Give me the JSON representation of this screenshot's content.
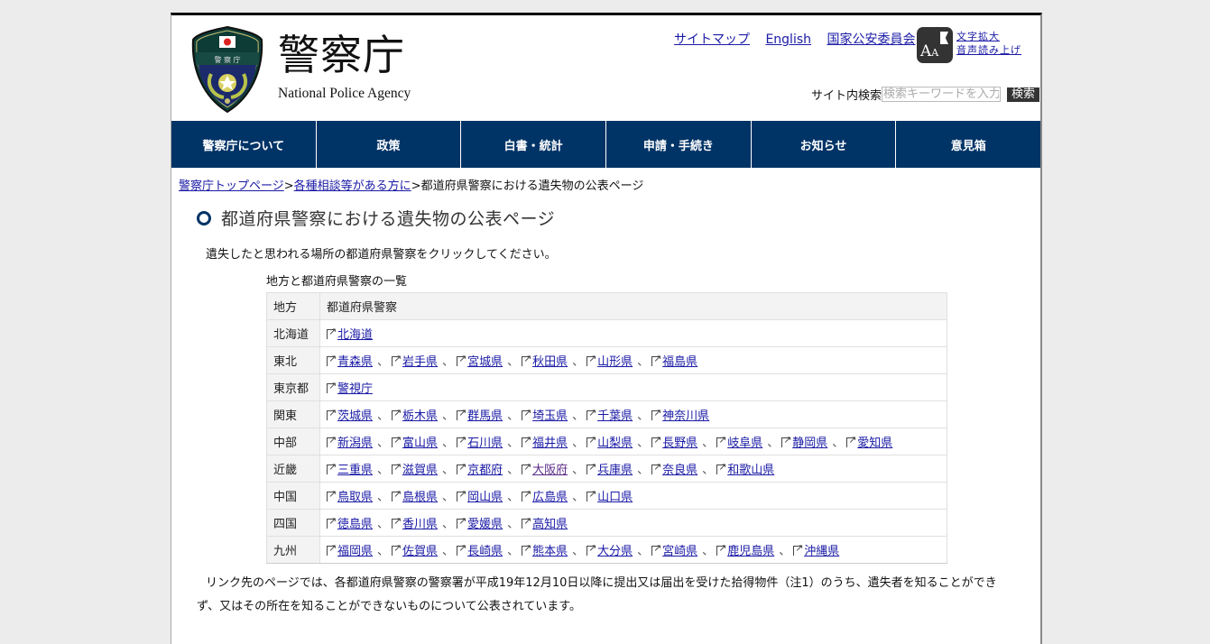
{
  "header": {
    "logo_title": "警察庁",
    "logo_subtitle": "National Police Agency",
    "top_links": [
      "サイトマップ",
      "English",
      "国家公安委員会"
    ],
    "accessibility_links": [
      "文字拡大",
      "音声読み上げ"
    ],
    "search": {
      "label": "サイト内検索",
      "placeholder": "検索キーワードを入力",
      "button": "検索"
    }
  },
  "nav": [
    "警察庁について",
    "政策",
    "白書・統計",
    "申請・手続き",
    "お知らせ",
    "意見箱"
  ],
  "breadcrumb": {
    "items": [
      "警察庁トップページ",
      "各種相談等がある方に"
    ],
    "separator": ">",
    "current": "都道府県警察における遺失物の公表ページ"
  },
  "page": {
    "title": "都道府県警察における遺失物の公表ページ",
    "intro": "遺失したと思われる場所の都道府県警察をクリックしてください。",
    "table_caption": "地方と都道府県警察の一覧",
    "note": "リンク先のページでは、各都道府県警察の警察署が平成19年12月10日以降に提出又は届出を受けた拾得物件（注1）のうち、遺失者を知ることができず、又はその所在を知ることができないものについて公表されています。"
  },
  "table": {
    "headers": [
      "地方",
      "都道府県警察"
    ],
    "separator": "、",
    "rows": [
      {
        "region": "北海道",
        "prefectures": [
          "北海道"
        ]
      },
      {
        "region": "東北",
        "prefectures": [
          "青森県",
          "岩手県",
          "宮城県",
          "秋田県",
          "山形県",
          "福島県"
        ]
      },
      {
        "region": "東京都",
        "prefectures": [
          "警視庁"
        ]
      },
      {
        "region": "関東",
        "prefectures": [
          "茨城県",
          "栃木県",
          "群馬県",
          "埼玉県",
          "千葉県",
          "神奈川県"
        ]
      },
      {
        "region": "中部",
        "prefectures": [
          "新潟県",
          "富山県",
          "石川県",
          "福井県",
          "山梨県",
          "長野県",
          "岐阜県",
          "静岡県",
          "愛知県"
        ]
      },
      {
        "region": "近畿",
        "prefectures": [
          "三重県",
          "滋賀県",
          "京都府",
          "大阪府",
          "兵庫県",
          "奈良県",
          "和歌山県"
        ],
        "visited": [
          "大阪府"
        ]
      },
      {
        "region": "中国",
        "prefectures": [
          "鳥取県",
          "島根県",
          "岡山県",
          "広島県",
          "山口県"
        ]
      },
      {
        "region": "四国",
        "prefectures": [
          "徳島県",
          "香川県",
          "愛媛県",
          "高知県"
        ]
      },
      {
        "region": "九州",
        "prefectures": [
          "福岡県",
          "佐賀県",
          "長崎県",
          "熊本県",
          "大分県",
          "宮崎県",
          "鹿児島県",
          "沖縄県"
        ]
      }
    ]
  },
  "colors": {
    "nav_bg": "#003366",
    "link": "#1a1aa6",
    "visited_link": "#5a2a86",
    "page_bg": "#ececec"
  }
}
